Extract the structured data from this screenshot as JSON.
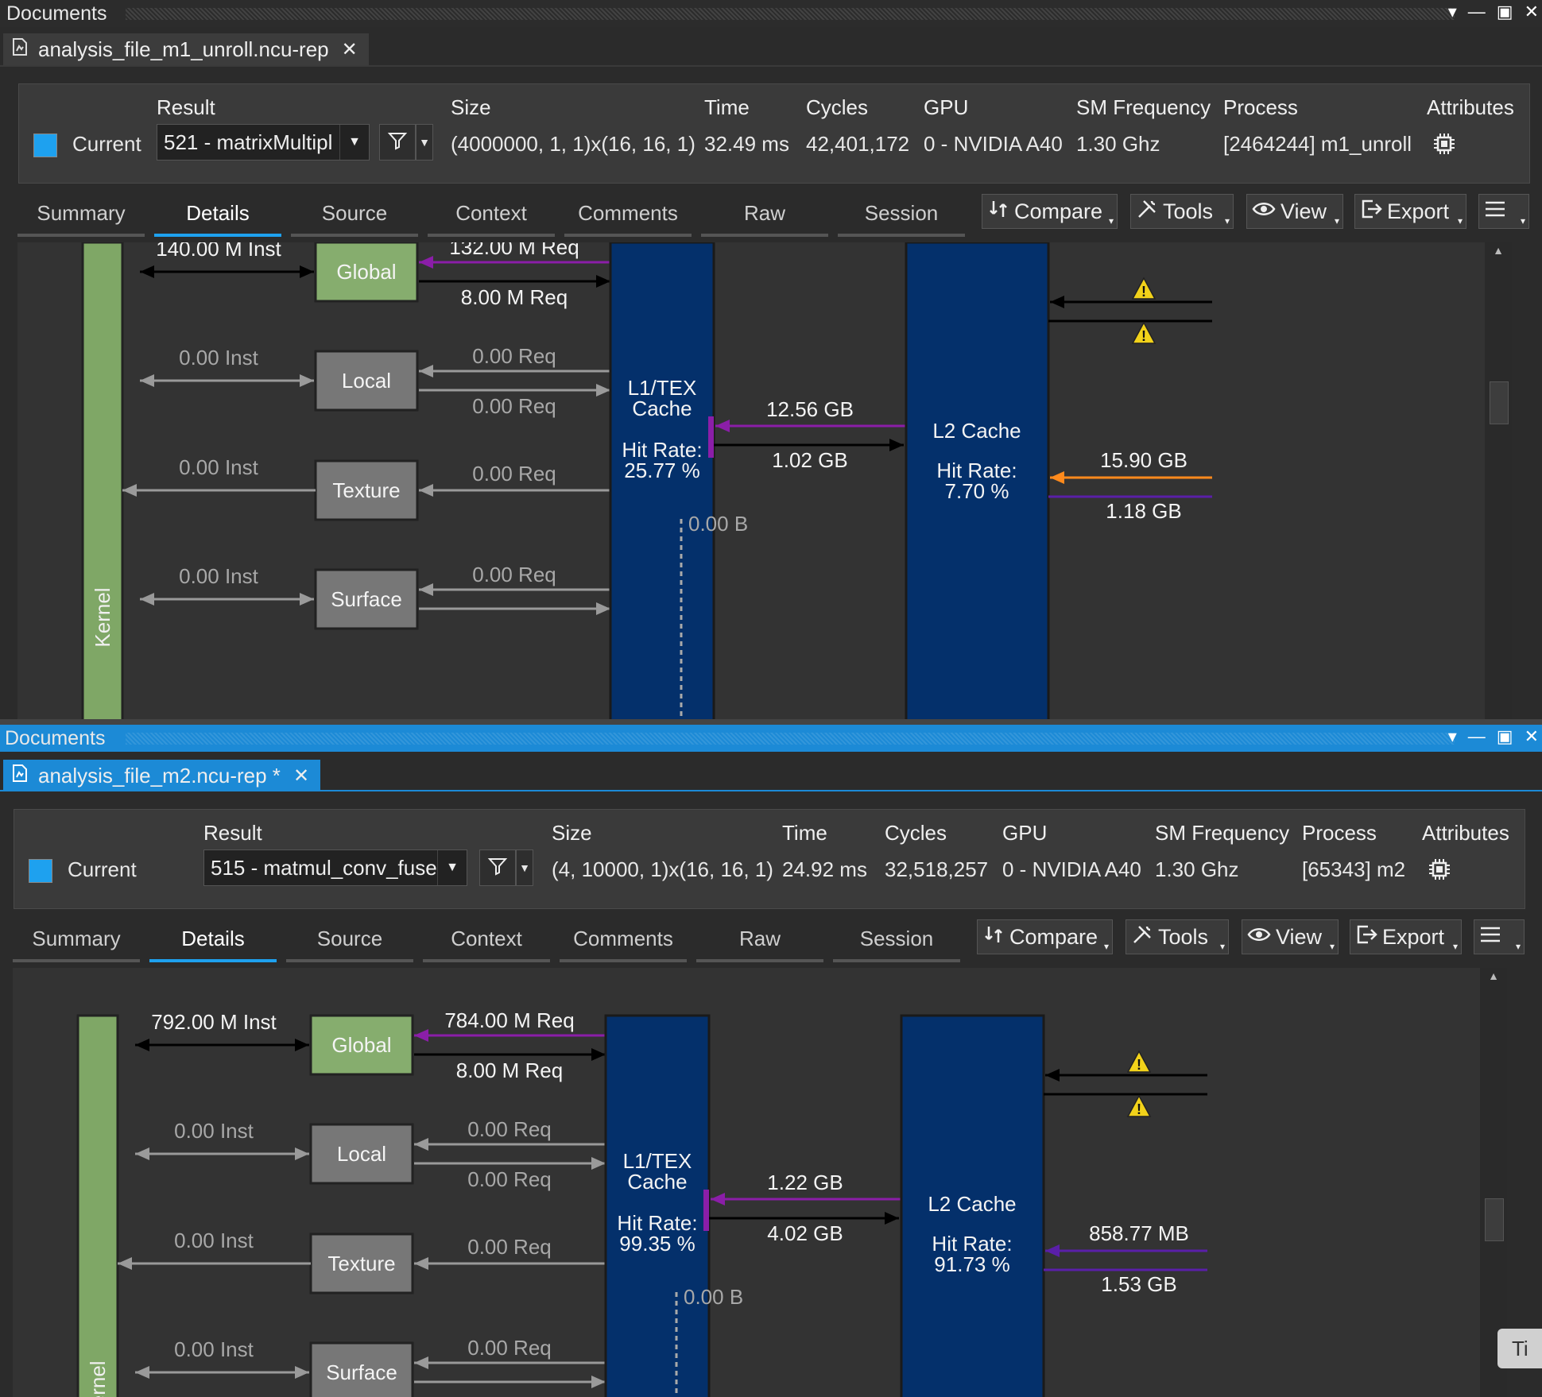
{
  "colors": {
    "accent": "#1c8ad6",
    "kernel_green": "#7fa766",
    "global_green": "#86ad6e",
    "memory_gray": "#777777",
    "cache_blue": "#04306b",
    "req_purple_load": "#8b1ea8",
    "req_purple_bus": "#5a1fa8",
    "orange": "#ff8a1c",
    "warning_yellow": "#f2d21a"
  },
  "icons": {
    "report": "report-file-icon",
    "close": "close-icon",
    "filter": "filter-icon",
    "attributes": "chip-icon",
    "warning": "warning-icon",
    "compare": "compare-icon",
    "tools": "tools-icon",
    "view": "eye-icon",
    "export": "export-icon",
    "menu": "hamburger-menu-icon"
  },
  "panels": [
    {
      "header_title": "Documents",
      "tab_label": "analysis_file_m1_unroll.ncu-rep",
      "result_bar": {
        "labels": {
          "result": "Result",
          "size": "Size",
          "time": "Time",
          "cycles": "Cycles",
          "gpu": "GPU",
          "sm_frequency": "SM Frequency",
          "process": "Process",
          "attributes": "Attributes"
        },
        "current_label": "Current",
        "result_value": "521 - matrixMultipl",
        "size": "(4000000, 1, 1)x(16, 16, 1)",
        "time": "32.49 ms",
        "cycles": "42,401,172",
        "gpu": "0 - NVIDIA A40",
        "sm_frequency": "1.30 Ghz",
        "process": "[2464244] m1_unroll"
      },
      "nav_tabs": [
        "Summary",
        "Details",
        "Source",
        "Context",
        "Comments",
        "Raw",
        "Session"
      ],
      "selected_tab": "Details",
      "toolbar": {
        "compare": "Compare",
        "tools": "Tools",
        "view": "View",
        "export": "Export"
      },
      "diagram": {
        "kernel": "Kernel",
        "mem": {
          "global": "Global",
          "local": "Local",
          "texture": "Texture",
          "surface": "Surface"
        },
        "inst": {
          "global": "140.00 M Inst",
          "local": "0.00 Inst",
          "texture": "0.00 Inst",
          "surface": "0.00 Inst"
        },
        "req": {
          "global_load": "132.00 M Req",
          "global_store": "8.00 M Req",
          "local_load": "0.00 Req",
          "local_store": "0.00 Req",
          "texture": "0.00 Req",
          "surface": "0.00 Req"
        },
        "l1": {
          "line1": "L1/TEX",
          "line2": "Cache",
          "hit_label": "Hit Rate:",
          "hit_value": "25.77 %"
        },
        "l1_l2": {
          "top": "12.56 GB",
          "bottom": "1.02 GB"
        },
        "l1_misc": "0.00 B",
        "l2": {
          "title": "L2 Cache",
          "hit_label": "Hit Rate:",
          "hit_value": "7.70 %"
        },
        "device": {
          "top": "15.90 GB",
          "bottom": "1.18 GB"
        }
      }
    },
    {
      "header_title": "Documents",
      "tab_label": "analysis_file_m2.ncu-rep *",
      "result_bar": {
        "labels": {
          "result": "Result",
          "size": "Size",
          "time": "Time",
          "cycles": "Cycles",
          "gpu": "GPU",
          "sm_frequency": "SM Frequency",
          "process": "Process",
          "attributes": "Attributes"
        },
        "current_label": "Current",
        "result_value": "515 - matmul_conv_fuse",
        "size": "(4, 10000, 1)x(16, 16, 1)",
        "time": "24.92 ms",
        "cycles": "32,518,257",
        "gpu": "0 - NVIDIA A40",
        "sm_frequency": "1.30 Ghz",
        "process": "[65343] m2"
      },
      "nav_tabs": [
        "Summary",
        "Details",
        "Source",
        "Context",
        "Comments",
        "Raw",
        "Session"
      ],
      "selected_tab": "Details",
      "toolbar": {
        "compare": "Compare",
        "tools": "Tools",
        "view": "View",
        "export": "Export"
      },
      "diagram": {
        "kernel": "Kernel",
        "mem": {
          "global": "Global",
          "local": "Local",
          "texture": "Texture",
          "surface": "Surface"
        },
        "inst": {
          "global": "792.00 M Inst",
          "local": "0.00 Inst",
          "texture": "0.00 Inst",
          "surface": "0.00 Inst"
        },
        "req": {
          "global_load": "784.00 M Req",
          "global_store": "8.00 M Req",
          "local_load": "0.00 Req",
          "local_store": "0.00 Req",
          "texture": "0.00 Req",
          "surface": "0.00 Req"
        },
        "l1": {
          "line1": "L1/TEX",
          "line2": "Cache",
          "hit_label": "Hit Rate:",
          "hit_value": "99.35 %"
        },
        "l1_l2": {
          "top": "1.22 GB",
          "bottom": "4.02 GB"
        },
        "l1_misc": "0.00 B",
        "l2": {
          "title": "L2 Cache",
          "hit_label": "Hit Rate:",
          "hit_value": "91.73 %"
        },
        "device": {
          "top": "858.77 MB",
          "bottom": "1.53 GB"
        }
      },
      "side_tab": "Ti"
    }
  ]
}
